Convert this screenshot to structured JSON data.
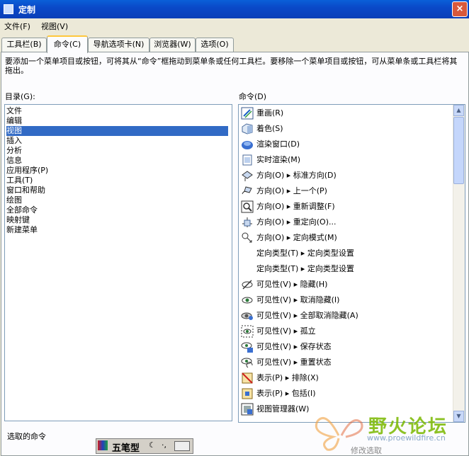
{
  "window": {
    "title": "定制",
    "close_glyph": "×"
  },
  "menu": [
    "文件(F)",
    "视图(V)"
  ],
  "tabs": [
    {
      "label": "工具栏(B)",
      "active": false
    },
    {
      "label": "命令(C)",
      "active": true
    },
    {
      "label": "导航选项卡(N)",
      "active": false
    },
    {
      "label": "浏览器(W)",
      "active": false
    },
    {
      "label": "选项(O)",
      "active": false
    }
  ],
  "instructions": "要添加一个菜单项目或按钮，可将其从“命令”框拖动到菜单条或任何工具栏。要移除一个菜单项目或按钮，可从菜单条或工具栏将其拖出。",
  "categories_label": "目录(G):",
  "commands_label": "命令(D)",
  "categories": [
    "文件",
    "编辑",
    "视图",
    "插入",
    "分析",
    "信息",
    "应用程序(P)",
    "工具(T)",
    "窗口和帮助",
    "绘图",
    "全部命令",
    "映射键",
    "新建菜单"
  ],
  "selected_category": "视图",
  "commands": [
    {
      "label": "重画(R)",
      "icon": "repaint-icon"
    },
    {
      "label": "着色(S)",
      "icon": "shade-icon"
    },
    {
      "label": "渲染窗口(D)",
      "icon": "render-window-icon"
    },
    {
      "label": "实时渲染(M)",
      "icon": "realtime-render-icon"
    },
    {
      "label": "方向(O) ▸ 标准方向(D)",
      "icon": "standard-orient-icon"
    },
    {
      "label": "方向(O) ▸ 上一个(P)",
      "icon": "previous-orient-icon"
    },
    {
      "label": "方向(O) ▸ 重新调整(F)",
      "icon": "refit-icon"
    },
    {
      "label": "方向(O) ▸ 重定向(O)...",
      "icon": "reorient-icon"
    },
    {
      "label": "方向(O) ▸ 定向模式(M)",
      "icon": "orient-mode-icon"
    },
    {
      "label": "定向类型(T) ▸ 定向类型设置",
      "icon": ""
    },
    {
      "label": "定向类型(T) ▸ 定向类型设置",
      "icon": ""
    },
    {
      "label": "可见性(V) ▸ 隐藏(H)",
      "icon": "hide-icon"
    },
    {
      "label": "可见性(V) ▸ 取消隐藏(I)",
      "icon": "unhide-icon"
    },
    {
      "label": "可见性(V) ▸ 全部取消隐藏(A)",
      "icon": "unhide-all-icon"
    },
    {
      "label": "可见性(V) ▸ 孤立",
      "icon": "isolate-icon"
    },
    {
      "label": "可见性(V) ▸ 保存状态",
      "icon": "save-state-icon"
    },
    {
      "label": "可见性(V) ▸ 重置状态",
      "icon": "reset-state-icon"
    },
    {
      "label": "表示(P) ▸ 排除(X)",
      "icon": "exclude-icon"
    },
    {
      "label": "表示(P) ▸ 包括(I)",
      "icon": "include-icon"
    },
    {
      "label": "视图管理器(W)",
      "icon": "view-manager-icon"
    }
  ],
  "selected_command_label": "选取的命令",
  "modify_selection": "修改选取",
  "ime": {
    "mode": "五笔型"
  },
  "watermark": {
    "text": "野火论坛",
    "url": "www.proewildfire.cn"
  }
}
